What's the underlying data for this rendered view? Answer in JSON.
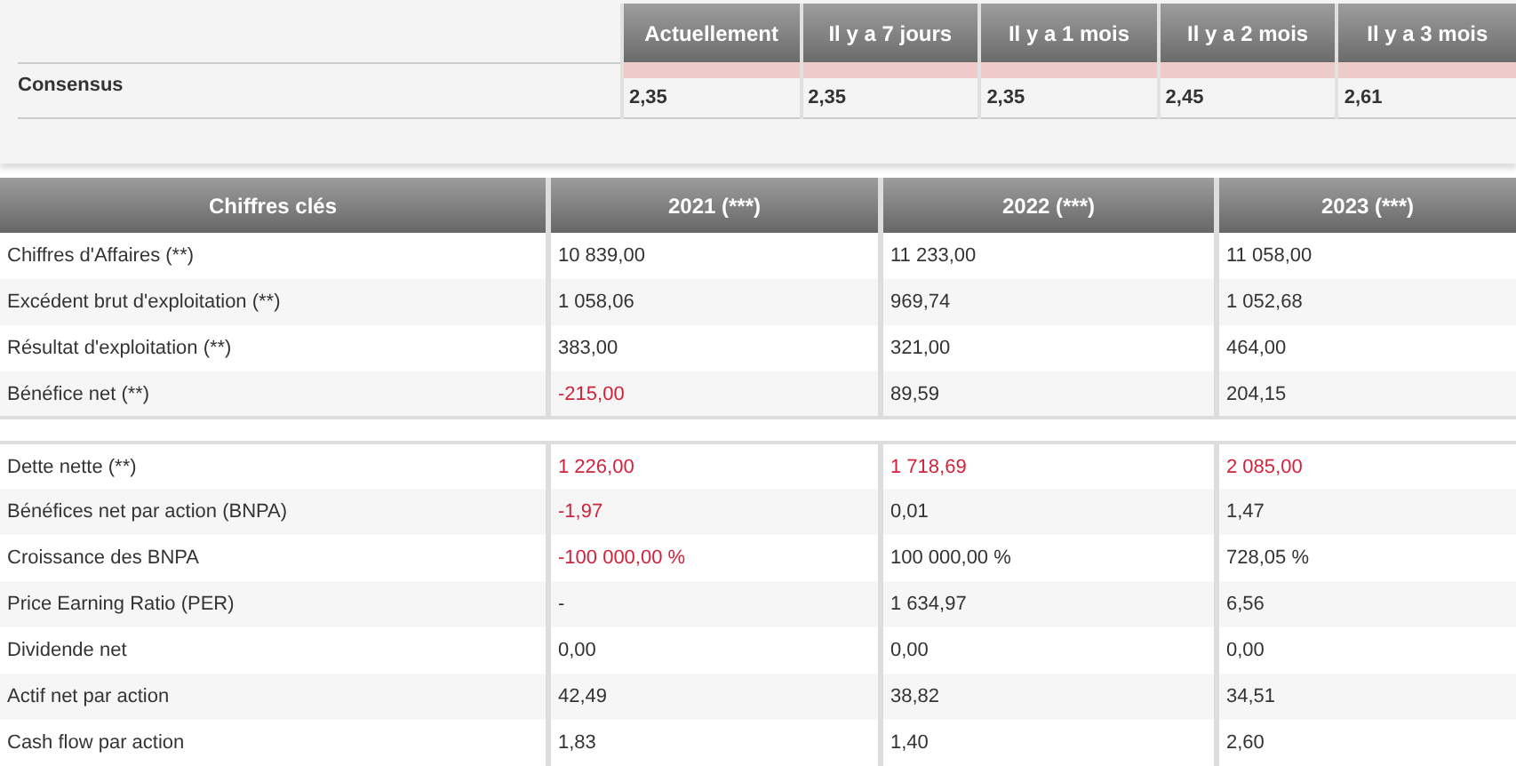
{
  "consensus": {
    "columns": [
      "Actuellement",
      "Il y a 7 jours",
      "Il y a 1 mois",
      "Il y a 2 mois",
      "Il y a 3 mois"
    ],
    "row": {
      "label": "Consensus",
      "values": [
        "2,35",
        "2,35",
        "2,35",
        "2,45",
        "2,61"
      ]
    }
  },
  "key_figures": {
    "columns": [
      "Chiffres clés",
      "2021 (***)",
      "2022 (***)",
      "2023 (***)"
    ],
    "groups": [
      {
        "rows": [
          {
            "label": "Chiffres d'Affaires (**)",
            "values": [
              {
                "text": "10 839,00",
                "negative": false
              },
              {
                "text": "11 233,00",
                "negative": false
              },
              {
                "text": "11 058,00",
                "negative": false
              }
            ]
          },
          {
            "label": "Excédent brut d'exploitation (**)",
            "values": [
              {
                "text": "1 058,06",
                "negative": false
              },
              {
                "text": "969,74",
                "negative": false
              },
              {
                "text": "1 052,68",
                "negative": false
              }
            ]
          },
          {
            "label": "Résultat d'exploitation (**)",
            "values": [
              {
                "text": "383,00",
                "negative": false
              },
              {
                "text": "321,00",
                "negative": false
              },
              {
                "text": "464,00",
                "negative": false
              }
            ]
          },
          {
            "label": "Bénéfice net (**)",
            "values": [
              {
                "text": "-215,00",
                "negative": true
              },
              {
                "text": "89,59",
                "negative": false
              },
              {
                "text": "204,15",
                "negative": false
              }
            ]
          }
        ]
      },
      {
        "rows": [
          {
            "label": "Dette nette (**)",
            "values": [
              {
                "text": "1 226,00",
                "negative": true
              },
              {
                "text": "1 718,69",
                "negative": true
              },
              {
                "text": "2 085,00",
                "negative": true
              }
            ]
          },
          {
            "label": "Bénéfices net par action (BNPA)",
            "values": [
              {
                "text": "-1,97",
                "negative": true
              },
              {
                "text": "0,01",
                "negative": false
              },
              {
                "text": "1,47",
                "negative": false
              }
            ]
          },
          {
            "label": "Croissance des BNPA",
            "values": [
              {
                "text": "-100 000,00 %",
                "negative": true
              },
              {
                "text": "100 000,00 %",
                "negative": false
              },
              {
                "text": "728,05 %",
                "negative": false
              }
            ]
          },
          {
            "label": "Price Earning Ratio (PER)",
            "values": [
              {
                "text": "-",
                "negative": false
              },
              {
                "text": "1 634,97",
                "negative": false
              },
              {
                "text": "6,56",
                "negative": false
              }
            ]
          },
          {
            "label": "Dividende net",
            "values": [
              {
                "text": "0,00",
                "negative": false
              },
              {
                "text": "0,00",
                "negative": false
              },
              {
                "text": "0,00",
                "negative": false
              }
            ]
          },
          {
            "label": "Actif net par action",
            "values": [
              {
                "text": "42,49",
                "negative": false
              },
              {
                "text": "38,82",
                "negative": false
              },
              {
                "text": "34,51",
                "negative": false
              }
            ]
          },
          {
            "label": "Cash flow par action",
            "values": [
              {
                "text": "1,83",
                "negative": false
              },
              {
                "text": "1,40",
                "negative": false
              },
              {
                "text": "2,60",
                "negative": false
              }
            ]
          }
        ]
      }
    ]
  }
}
